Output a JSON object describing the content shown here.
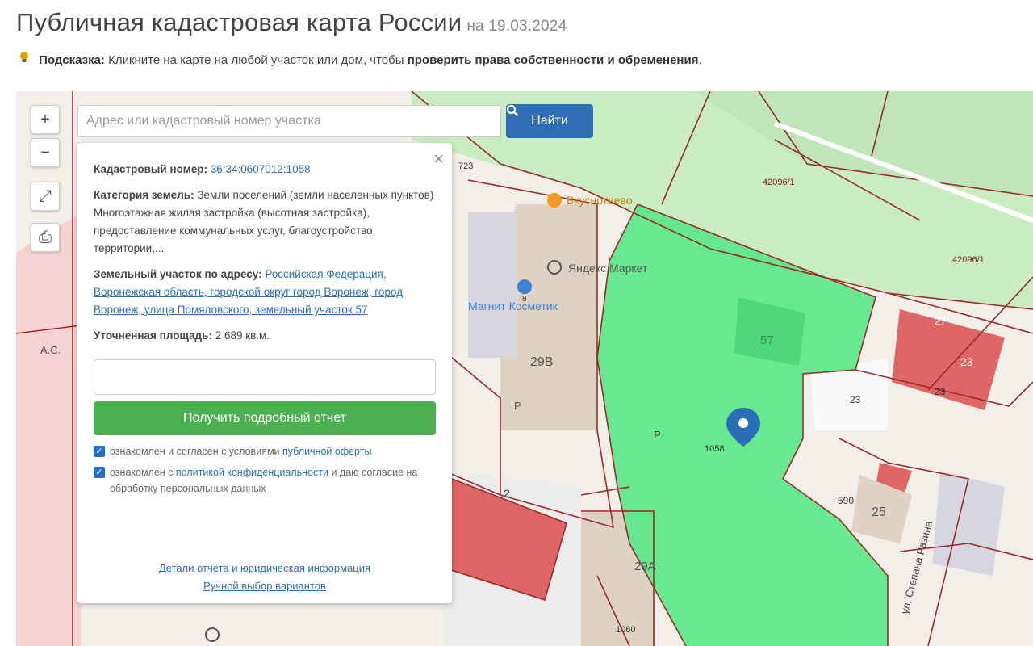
{
  "header": {
    "title": "Публичная кадастровая карта России",
    "date": "на 19.03.2024"
  },
  "hint": {
    "label": "Подсказка:",
    "text": "Кликните на карте на любой участок или дом, чтобы",
    "bold_text": "проверить права собственности и обременения",
    "end": "."
  },
  "controls": {
    "zoom_in": "+",
    "zoom_out": "−",
    "measure": "⤢",
    "print": "⎙"
  },
  "search": {
    "placeholder": "Адрес или кадастровый номер участка",
    "button_label": "Найти",
    "button_icon": "search-icon"
  },
  "panel": {
    "close": "×",
    "cadastral_label": "Кадастровый номер:",
    "cadastral_value": "36:34:0607012:1058",
    "category_label": "Категория земель:",
    "category_value": "Земли поселений (земли населенных пунктов)",
    "usage_value": "Многоэтажная жилая застройка (высотная застройка), предоставление коммунальных услуг, благоустройство территории,...",
    "address_label": "Земельный участок по адресу:",
    "address_value": "Российская Федерация, Воронежская область, городской округ город Воронеж, город Воронеж, улица Помяловского, земельный участок 57",
    "area_label": "Уточненная площадь:",
    "area_value": "2 689 кв.м.",
    "email_placeholder": "",
    "report_button": "Получить подробный отчет",
    "consent1_text": "ознакомлен и согласен с условиями",
    "consent1_link": "публичной оферты",
    "consent2_text": "ознакомлен с",
    "consent2_link": "политикой конфиденциальности",
    "consent2_rest": "и даю согласие на обработку персональных данных",
    "link_details": "Детали отчета и юридическая информация",
    "link_manual": "Ручной выбор вариантов"
  },
  "map_labels": {
    "l723": "723",
    "poi_food": "Вкуснотеево",
    "poi_market": "Яндекс Маркет",
    "poi_cosmetics": "Магнит Косметик",
    "b29b": "29В",
    "b57": "57",
    "parcel1058": "1058",
    "p42096_1a": "42096/1",
    "p42096_1b": "42096/1",
    "b23a": "23",
    "b23b": "23",
    "b23c": "23",
    "b27": "27",
    "b590": "590",
    "b25": "25",
    "b29a": "29А",
    "b1060": "1060",
    "b8": "8",
    "b2": "2",
    "street": "ул. Степана Разина",
    "as": "А.С.",
    "pz1": "Р",
    "pz2": "Р"
  },
  "colors": {
    "parcel_green": "#5ee88a",
    "button_blue": "#2f6db5",
    "report_green": "#4caf50",
    "link_blue": "#2a6fb5",
    "parcel_border": "#9b2a2a"
  }
}
